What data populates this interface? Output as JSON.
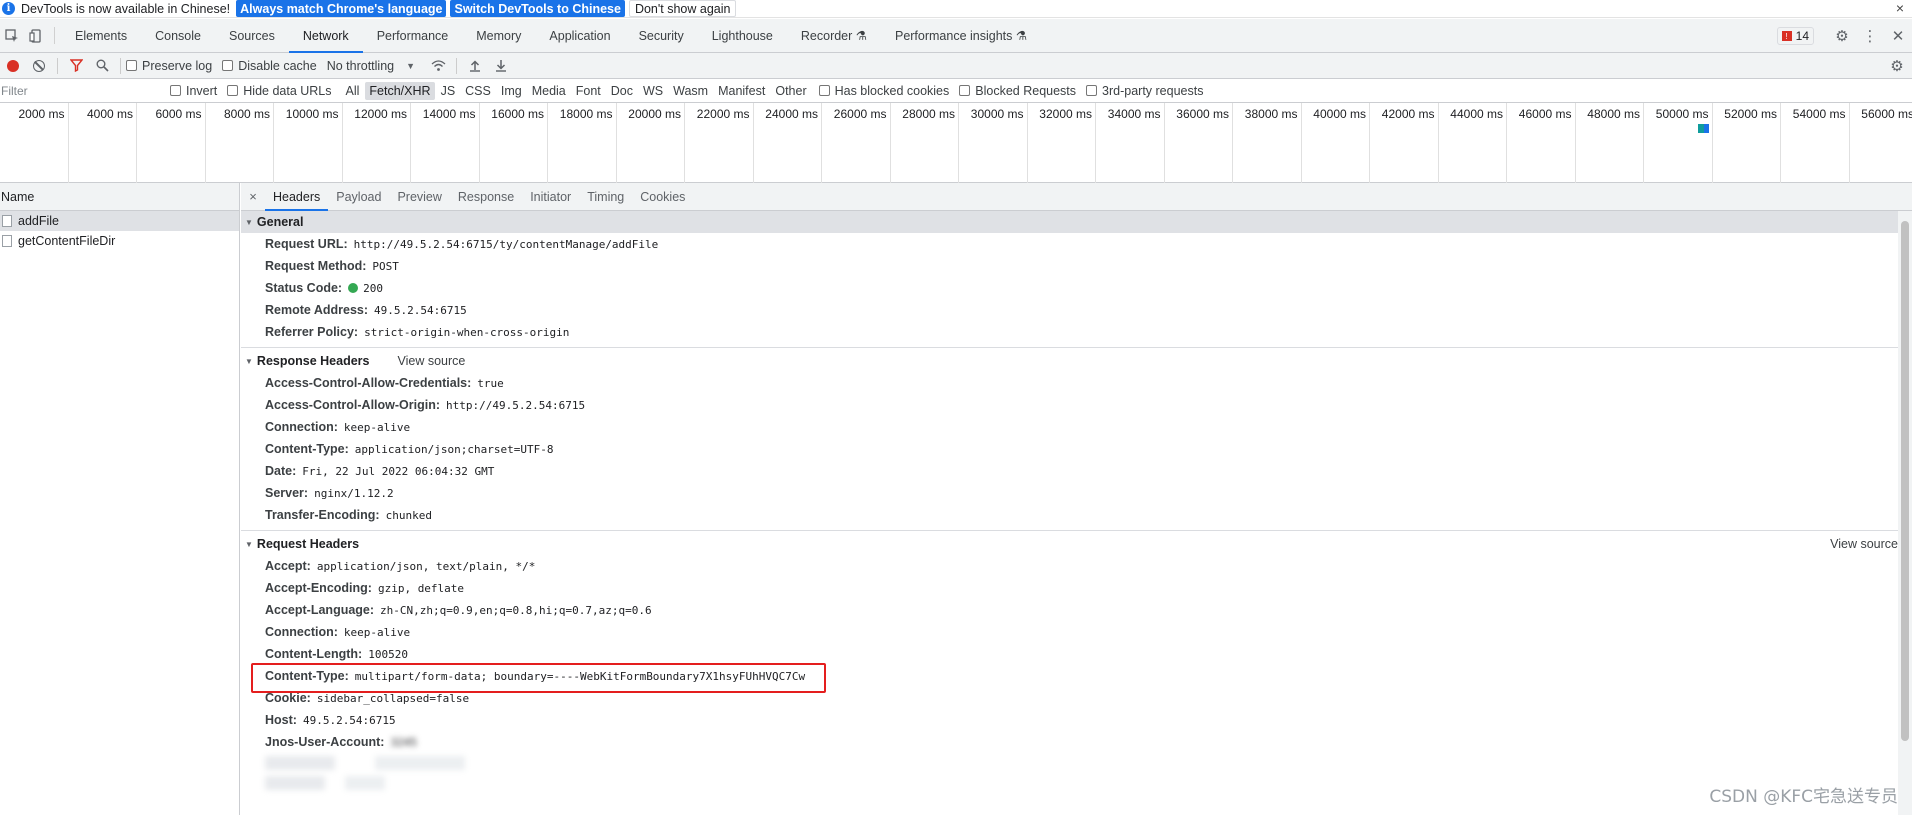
{
  "infobar": {
    "message": "DevTools is now available in Chinese!",
    "btn_match": "Always match Chrome's language",
    "btn_switch": "Switch DevTools to Chinese",
    "btn_dont_show": "Don't show again",
    "close": "×"
  },
  "tabs": {
    "items": [
      "Elements",
      "Console",
      "Sources",
      "Network",
      "Performance",
      "Memory",
      "Application",
      "Security",
      "Lighthouse",
      "Recorder ⚗",
      "Performance insights ⚗"
    ],
    "active": "Network",
    "issues_count": "14"
  },
  "network_toolbar": {
    "preserve_log": "Preserve log",
    "disable_cache": "Disable cache",
    "throttling": "No throttling"
  },
  "filter_bar": {
    "placeholder": "Filter",
    "invert": "Invert",
    "hide_data_urls": "Hide data URLs",
    "types": [
      "All",
      "Fetch/XHR",
      "JS",
      "CSS",
      "Img",
      "Media",
      "Font",
      "Doc",
      "WS",
      "Wasm",
      "Manifest",
      "Other"
    ],
    "active_type": "Fetch/XHR",
    "has_blocked_cookies": "Has blocked cookies",
    "blocked_requests": "Blocked Requests",
    "third_party": "3rd-party requests"
  },
  "timeline": {
    "ticks": [
      "2000 ms",
      "4000 ms",
      "6000 ms",
      "8000 ms",
      "10000 ms",
      "12000 ms",
      "14000 ms",
      "16000 ms",
      "18000 ms",
      "20000 ms",
      "22000 ms",
      "24000 ms",
      "26000 ms",
      "28000 ms",
      "30000 ms",
      "32000 ms",
      "34000 ms",
      "36000 ms",
      "38000 ms",
      "40000 ms",
      "42000 ms",
      "44000 ms",
      "46000 ms",
      "48000 ms",
      "50000 ms",
      "52000 ms",
      "54000 ms",
      "56000 ms"
    ]
  },
  "requests": {
    "header": "Name",
    "items": [
      {
        "name": "addFile",
        "selected": true
      },
      {
        "name": "getContentFileDir",
        "selected": false
      }
    ]
  },
  "details": {
    "close": "×",
    "tabs": [
      "Headers",
      "Payload",
      "Preview",
      "Response",
      "Initiator",
      "Timing",
      "Cookies"
    ],
    "active_tab": "Headers",
    "general": {
      "title": "General",
      "rows": [
        {
          "k": "Request URL:",
          "v": "http://49.5.2.54:6715/ty/contentManage/addFile"
        },
        {
          "k": "Request Method:",
          "v": "POST"
        },
        {
          "k": "Status Code:",
          "v": "200"
        },
        {
          "k": "Remote Address:",
          "v": "49.5.2.54:6715"
        },
        {
          "k": "Referrer Policy:",
          "v": "strict-origin-when-cross-origin"
        }
      ]
    },
    "response_headers": {
      "title": "Response Headers",
      "view_source": "View source",
      "rows": [
        {
          "k": "Access-Control-Allow-Credentials:",
          "v": "true"
        },
        {
          "k": "Access-Control-Allow-Origin:",
          "v": "http://49.5.2.54:6715"
        },
        {
          "k": "Connection:",
          "v": "keep-alive"
        },
        {
          "k": "Content-Type:",
          "v": "application/json;charset=UTF-8"
        },
        {
          "k": "Date:",
          "v": "Fri, 22 Jul 2022 06:04:32 GMT"
        },
        {
          "k": "Server:",
          "v": "nginx/1.12.2"
        },
        {
          "k": "Transfer-Encoding:",
          "v": "chunked"
        }
      ]
    },
    "request_headers": {
      "title": "Request Headers",
      "view_source": "View source",
      "rows": [
        {
          "k": "Accept:",
          "v": "application/json, text/plain, */*"
        },
        {
          "k": "Accept-Encoding:",
          "v": "gzip, deflate"
        },
        {
          "k": "Accept-Language:",
          "v": "zh-CN,zh;q=0.9,en;q=0.8,hi;q=0.7,az;q=0.6"
        },
        {
          "k": "Connection:",
          "v": "keep-alive"
        },
        {
          "k": "Content-Length:",
          "v": "100520"
        },
        {
          "k": "Content-Type:",
          "v": "multipart/form-data; boundary=----WebKitFormBoundary7X1hsyFUhHVQC7Cw"
        },
        {
          "k": "Cookie:",
          "v": "sidebar_collapsed=false"
        },
        {
          "k": "Host:",
          "v": "49.5.2.54:6715"
        },
        {
          "k": "Jnos-User-Account:",
          "v": "3245"
        }
      ]
    }
  },
  "watermark": "CSDN @KFC宅急送专员"
}
